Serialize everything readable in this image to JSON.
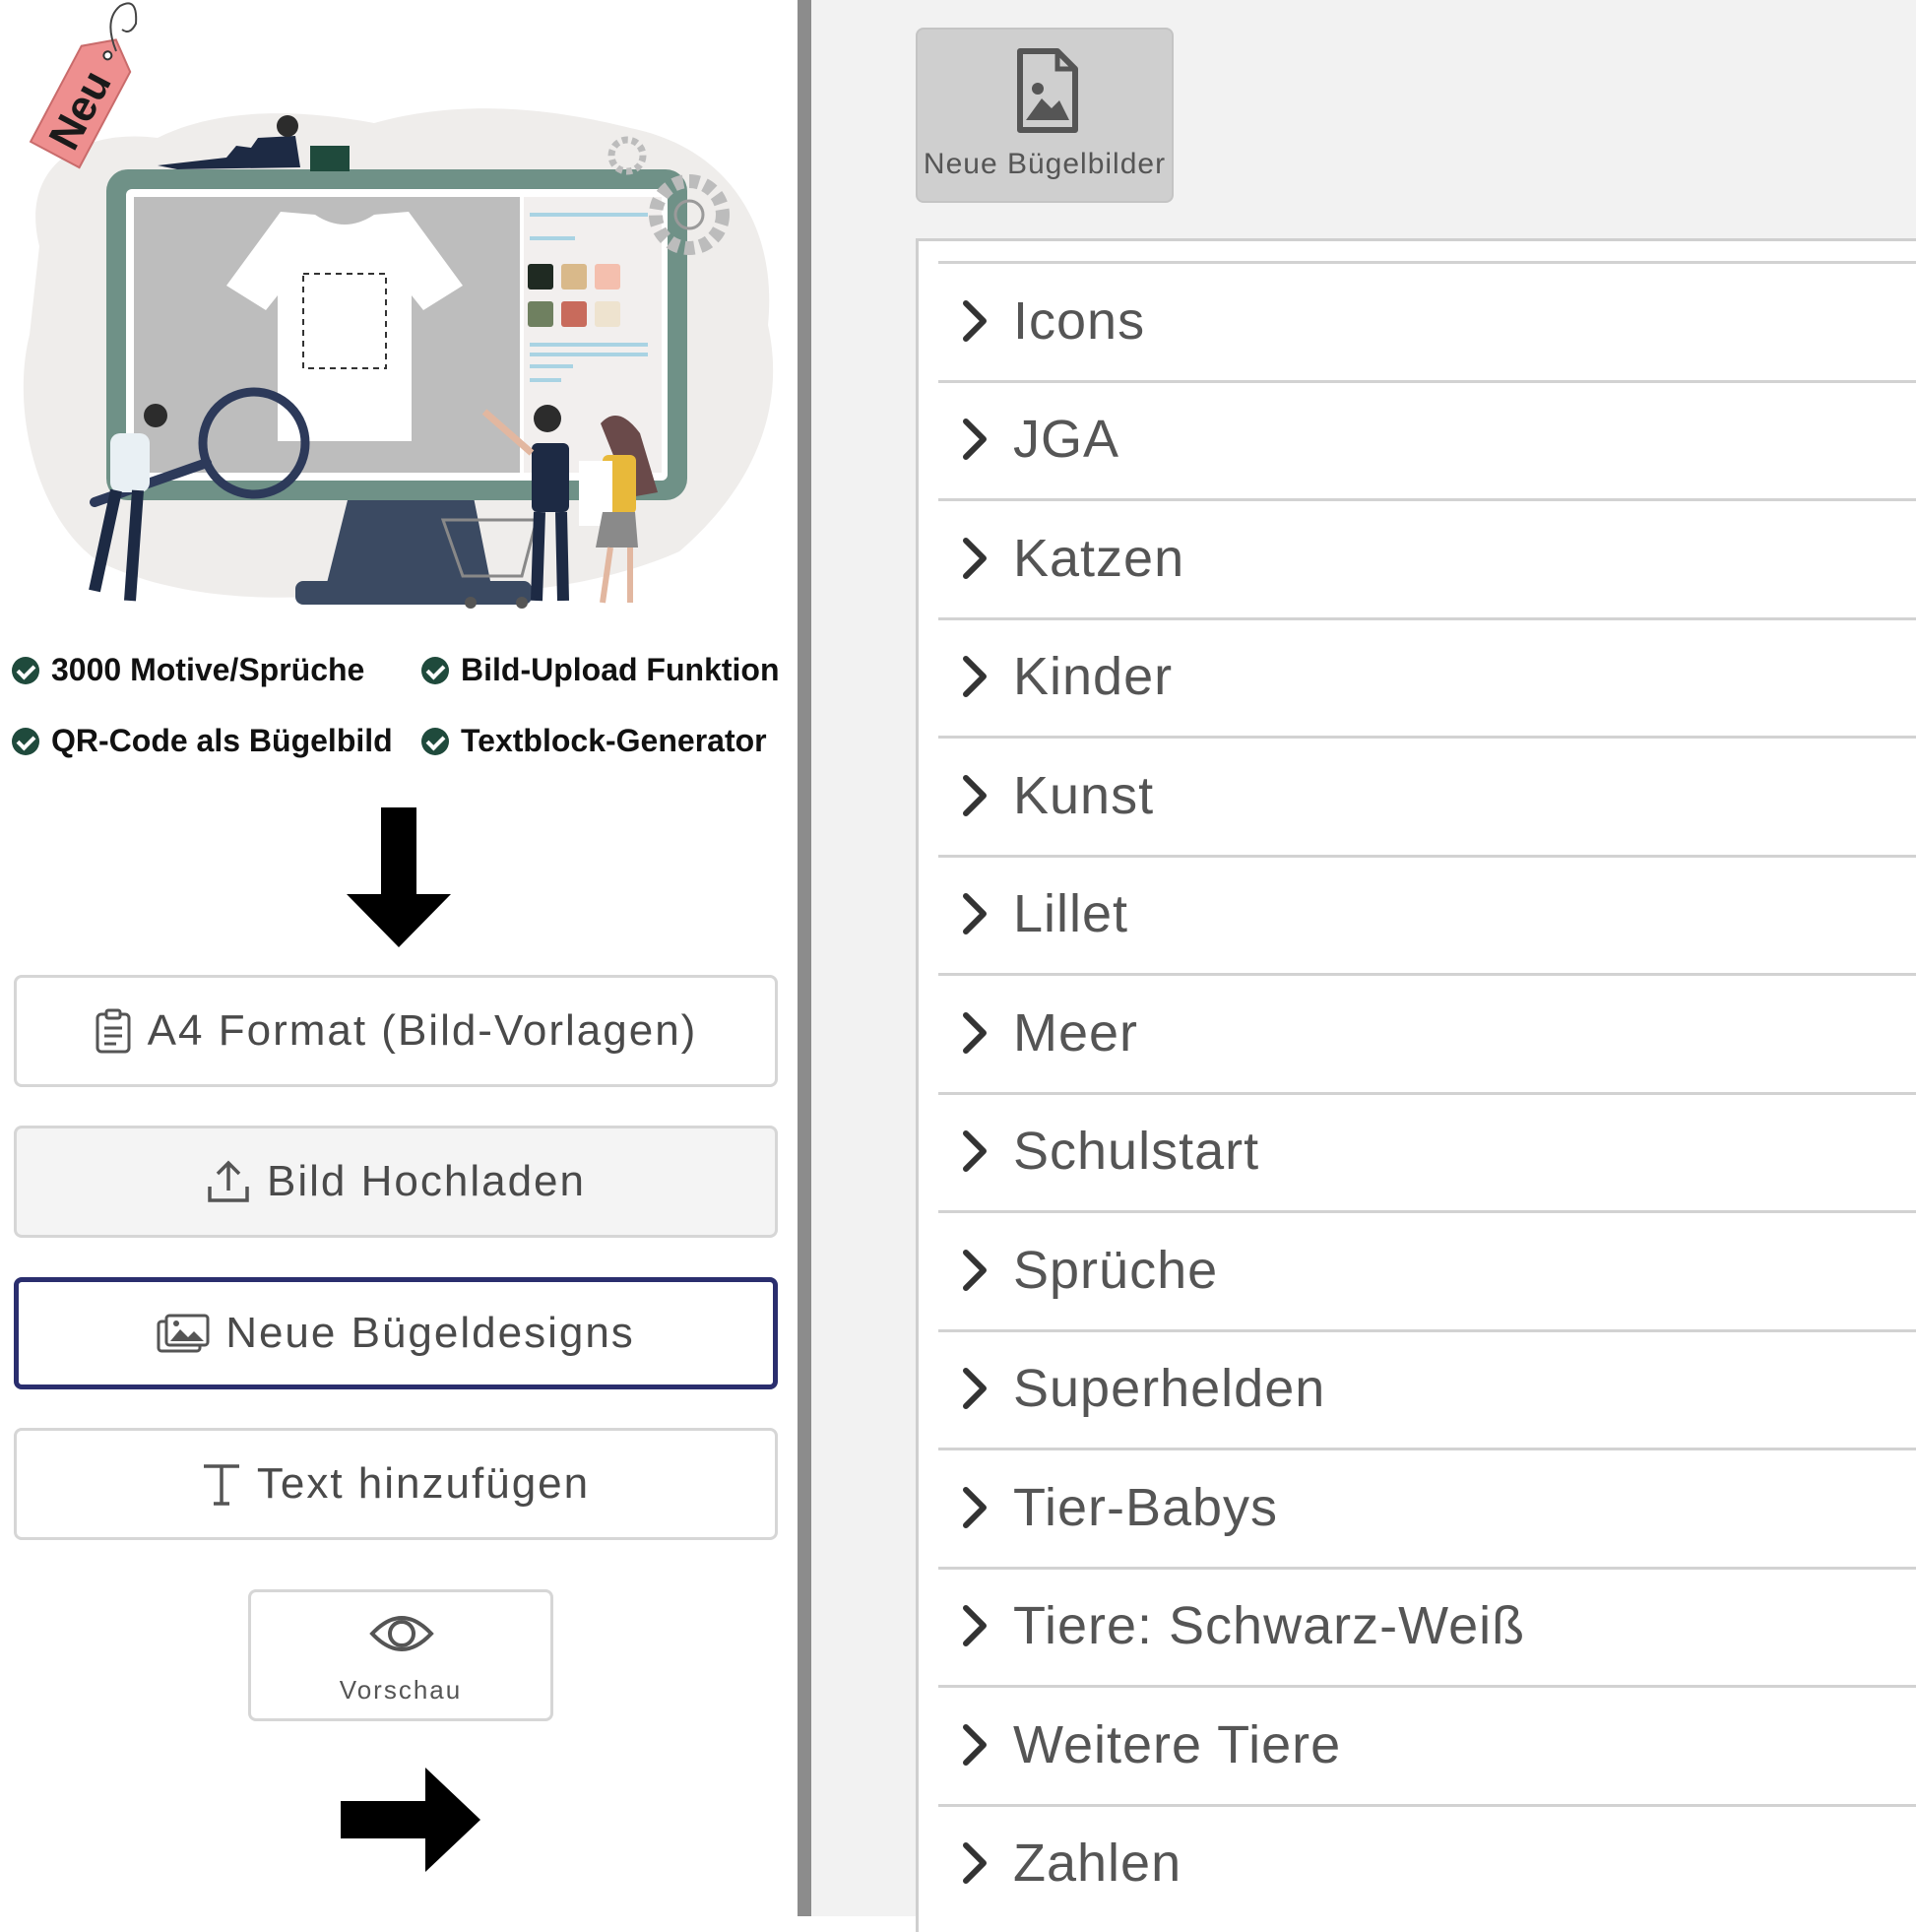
{
  "promo": {
    "tag": "Neu",
    "features": [
      "3000 Motive/Sprüche",
      "Bild-Upload Funktion",
      "QR-Code als Bügelbild",
      "Textblock-Generator"
    ]
  },
  "buttons": {
    "a4": "A4 Format (Bild-Vorlagen)",
    "upload": "Bild Hochladen",
    "designs": "Neue Bügeldesigns",
    "text": "Text hinzufügen",
    "preview": "Vorschau"
  },
  "right": {
    "tile": "Neue Bügelbilder",
    "categories": [
      "Icons",
      "JGA",
      "Katzen",
      "Kinder",
      "Kunst",
      "Lillet",
      "Meer",
      "Schulstart",
      "Sprüche",
      "Superhelden",
      "Tier-Babys",
      "Tiere: Schwarz-Weiß",
      "Weitere Tiere",
      "Zahlen"
    ]
  },
  "colors": {
    "accent": "#2a2e6e",
    "check": "#1f4a3c",
    "tag": "#ee8f8f",
    "monitor": "#6f9187"
  }
}
